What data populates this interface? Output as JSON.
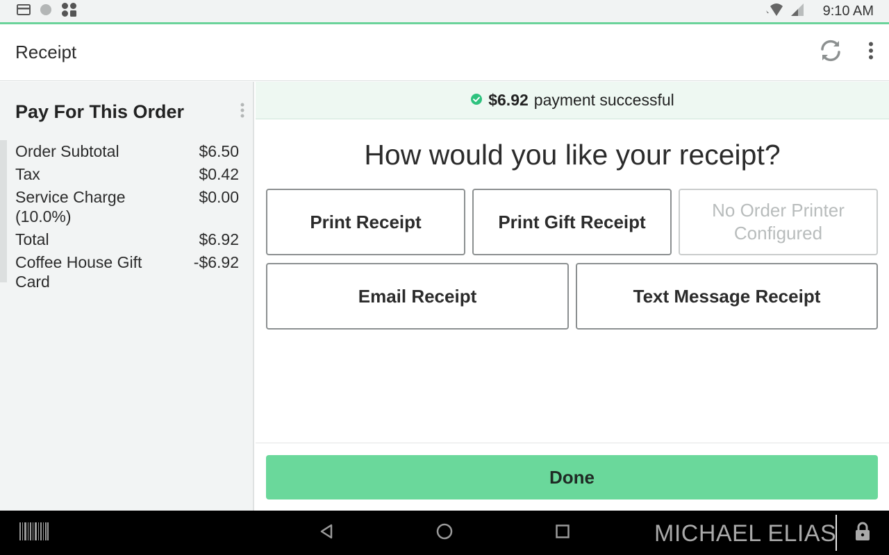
{
  "status_bar": {
    "time": "9:10 AM"
  },
  "app_bar": {
    "title": "Receipt"
  },
  "order_panel": {
    "title": "Pay For This Order",
    "rows": [
      {
        "label": "Order Subtotal",
        "value": "$6.50"
      },
      {
        "label": "Tax",
        "value": "$0.42"
      },
      {
        "label": "Service Charge (10.0%)",
        "value": "$0.00"
      },
      {
        "label": "Total",
        "value": "$6.92"
      },
      {
        "label": "Coffee House Gift Card",
        "value": "-$6.92"
      }
    ]
  },
  "banner": {
    "amount": "$6.92",
    "message": "payment successful"
  },
  "question": "How would you like your receipt?",
  "buttons": {
    "print_receipt": "Print Receipt",
    "print_gift_receipt": "Print Gift Receipt",
    "no_order_printer": "No Order Printer Configured",
    "email_receipt": "Email Receipt",
    "text_message_receipt": "Text Message Receipt",
    "done": "Done"
  },
  "nav_bar": {
    "user": "MICHAEL ELIAS"
  },
  "colors": {
    "accent_green": "#6ad89b",
    "success_green": "#2ec27e",
    "banner_bg": "#eef8f2"
  }
}
